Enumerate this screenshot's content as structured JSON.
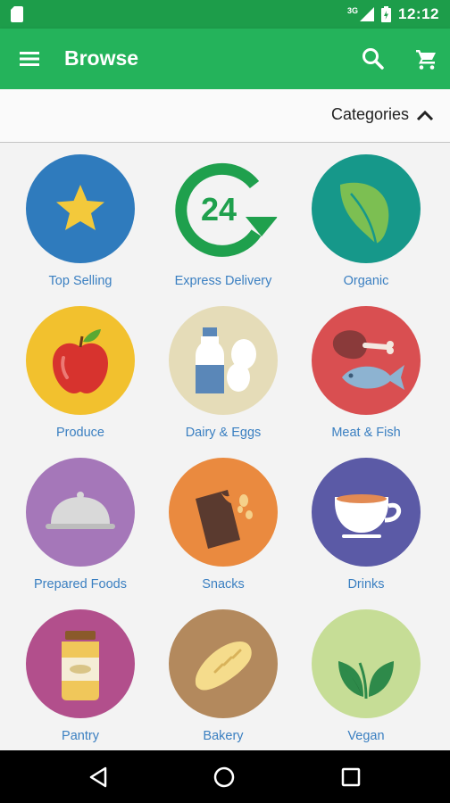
{
  "status_bar": {
    "network": "3G",
    "time": "12:12"
  },
  "app_bar": {
    "title": "Browse",
    "color": "#24b35b",
    "menu_icon": "hamburger-menu-icon",
    "search_icon": "search-icon",
    "cart_icon": "shopping-cart-icon"
  },
  "categories_bar": {
    "label": "Categories",
    "state_icon": "chevron-up-icon"
  },
  "categories": [
    {
      "label": "Top Selling",
      "icon": "star-icon",
      "color": "#2f7bbd"
    },
    {
      "label": "Express Delivery",
      "icon": "delivery-24-icon",
      "color": "#1fa04d"
    },
    {
      "label": "Organic",
      "icon": "leaf-icon",
      "color": "#16988a"
    },
    {
      "label": "Produce",
      "icon": "apple-icon",
      "color": "#f2c12e"
    },
    {
      "label": "Dairy & Eggs",
      "icon": "milk-eggs-icon",
      "color": "#e5dcb8"
    },
    {
      "label": "Meat & Fish",
      "icon": "meat-fish-icon",
      "color": "#d94f51"
    },
    {
      "label": "Prepared Foods",
      "icon": "cloche-icon",
      "color": "#a577b9"
    },
    {
      "label": "Snacks",
      "icon": "chocolate-icon",
      "color": "#ea8a3f"
    },
    {
      "label": "Drinks",
      "icon": "teacup-icon",
      "color": "#5b5aa6"
    },
    {
      "label": "Pantry",
      "icon": "jar-icon",
      "color": "#b24f8c"
    },
    {
      "label": "Bakery",
      "icon": "bread-icon",
      "color": "#b3895d"
    },
    {
      "label": "Vegan",
      "icon": "sprout-icon",
      "color": "#c6dd96"
    }
  ],
  "nav_bar": {
    "back_icon": "back-triangle-icon",
    "home_icon": "home-circle-icon",
    "recents_icon": "recents-square-icon"
  }
}
